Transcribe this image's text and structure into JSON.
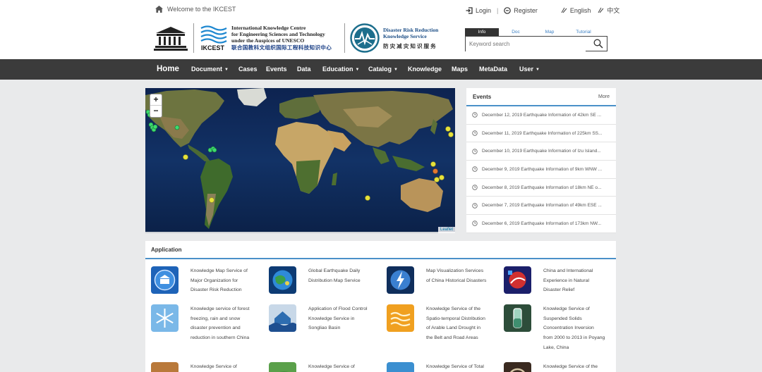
{
  "header": {
    "welcome": "Welcome to the IKCEST",
    "login": "Login",
    "register": "Register",
    "lang_en": "English",
    "lang_cn": "中文",
    "ikcest_title": [
      "International Knowledge Centre",
      "for Engineering Sciences and Technology",
      "under the Auspices of UNESCO"
    ],
    "ikcest_cn": "联合国教科文组织国际工程科技知识中心",
    "ikcest_mark": "IKCEST",
    "unesco_mark": "UNESCO",
    "drr_title": [
      "Disaster Risk Reduction",
      "Knowledge Service"
    ],
    "drr_cn": "防灾减灾知识服务"
  },
  "search": {
    "tabs": [
      "Info",
      "Doc",
      "Map",
      "Tutorial"
    ],
    "active_tab": "Info",
    "placeholder": "Keyword search"
  },
  "nav": {
    "items": [
      {
        "label": "Home",
        "dropdown": false
      },
      {
        "label": "Document",
        "dropdown": true
      },
      {
        "label": "Cases",
        "dropdown": false
      },
      {
        "label": "Events",
        "dropdown": false
      },
      {
        "label": "Data",
        "dropdown": false
      },
      {
        "label": "Education",
        "dropdown": true
      },
      {
        "label": "Catalog",
        "dropdown": true
      },
      {
        "label": "Knowledge",
        "dropdown": false
      },
      {
        "label": "Maps",
        "dropdown": false
      },
      {
        "label": "MetaData",
        "dropdown": false
      },
      {
        "label": "User",
        "dropdown": true
      }
    ]
  },
  "map": {
    "zoom_in": "+",
    "zoom_out": "−",
    "attribution": "Leaflet"
  },
  "events": {
    "title": "Events",
    "more": "More",
    "items": [
      "December 12, 2019 Earthquake Information of 42km SE ...",
      "December 11, 2019 Earthquake Information of 225km SS...",
      "December 10, 2019 Earthquake Information of Izu Island...",
      "December 9, 2019 Earthquake Information of 9km WNW ...",
      "December 8, 2019 Earthquake Information of 18km NE o...",
      "December 7, 2019 Earthquake Information of 49km ESE ...",
      "December 6, 2019 Earthquake Information of 173km NW..."
    ]
  },
  "application": {
    "title": "Application",
    "items": [
      {
        "lines": [
          "Knowledge Map Service of",
          "Major Organization for",
          "Disaster Risk Reduction"
        ],
        "icon": "building-icon"
      },
      {
        "lines": [
          "Global Earthquake Daily",
          "Distribution Map Service"
        ],
        "icon": "globe-icon"
      },
      {
        "lines": [
          "Map Visualization Services",
          "of China Historical Disasters"
        ],
        "icon": "lightning-icon"
      },
      {
        "lines": [
          "China and International",
          "Experience in Natural",
          "Disaster Relief"
        ],
        "icon": "relief-icon"
      },
      {
        "lines": [
          "Knowledge service of forest",
          "freezing, rain and snow",
          "disaster prevention and",
          "reduction in southern China"
        ],
        "icon": "snowflake-icon"
      },
      {
        "lines": [
          "Application of Flood Control",
          "Knowledge Service in",
          "Songliao Basin"
        ],
        "icon": "flood-icon"
      },
      {
        "lines": [
          "Knowledge Service of the",
          "Spatio-temporal Distribution",
          "of Arable Land Drought in",
          "the Belt and Road Areas"
        ],
        "icon": "drought-icon"
      },
      {
        "lines": [
          "Knowledge Service of",
          "Suspended Solids",
          "Concentration Inversion",
          "from 2000 to 2013 in Poyang",
          "Lake, China"
        ],
        "icon": "water-sample-icon"
      },
      {
        "lines": [
          "Knowledge Service of"
        ],
        "icon": "landslide-icon"
      },
      {
        "lines": [
          "Knowledge Service of"
        ],
        "icon": "vegetation-icon"
      },
      {
        "lines": [
          "Knowledge Service of Total"
        ],
        "icon": "field-icon"
      },
      {
        "lines": [
          "Knowledge Service of the"
        ],
        "icon": "circle-icon"
      }
    ]
  },
  "colors": {
    "nav_bg": "#3b3b3b",
    "accent_blue": "#4a90c8",
    "page_bg": "#e9eaeb",
    "quake_yellow": "#e6e23a",
    "quake_green": "#3ddc6e",
    "quake_orange": "#e07830"
  }
}
